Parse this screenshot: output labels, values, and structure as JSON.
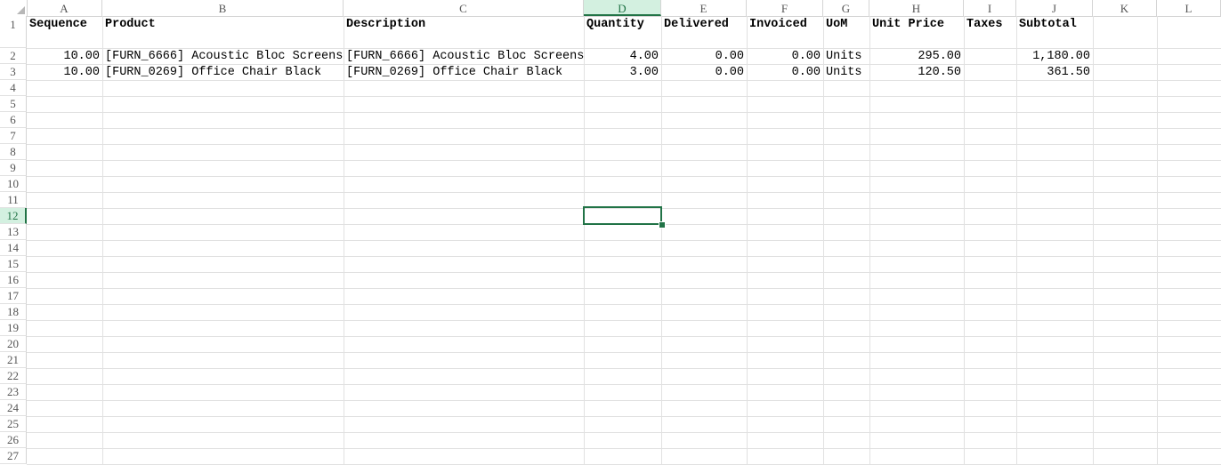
{
  "columns": [
    "A",
    "B",
    "C",
    "D",
    "E",
    "F",
    "G",
    "H",
    "I",
    "J",
    "K",
    "L"
  ],
  "rows": [
    "1",
    "2",
    "3",
    "4",
    "5",
    "6",
    "7",
    "8",
    "9",
    "10",
    "11",
    "12",
    "13",
    "14",
    "15",
    "16",
    "17",
    "18",
    "19",
    "20",
    "21",
    "22",
    "23",
    "24",
    "25",
    "26",
    "27"
  ],
  "active_cell": "D12",
  "header": [
    "Sequence",
    "Product",
    "Description",
    "Quantity",
    "Delivered",
    "Invoiced",
    "UoM",
    "Unit Price",
    "Taxes",
    "Subtotal"
  ],
  "lines": [
    [
      "10.00",
      "[FURN_6666] Acoustic Bloc Screens",
      "[FURN_6666] Acoustic Bloc Screens",
      "4.00",
      "0.00",
      "0.00",
      "Units",
      "295.00",
      "",
      "1,180.00"
    ],
    [
      "10.00",
      "[FURN_0269] Office Chair Black",
      "[FURN_0269] Office Chair Black",
      "3.00",
      "0.00",
      "0.00",
      "Units",
      "120.50",
      "",
      "361.50"
    ]
  ],
  "colors": {
    "accent": "#217346",
    "grid": "#e1e1e1",
    "header_active_bg": "#d3f0e0"
  }
}
